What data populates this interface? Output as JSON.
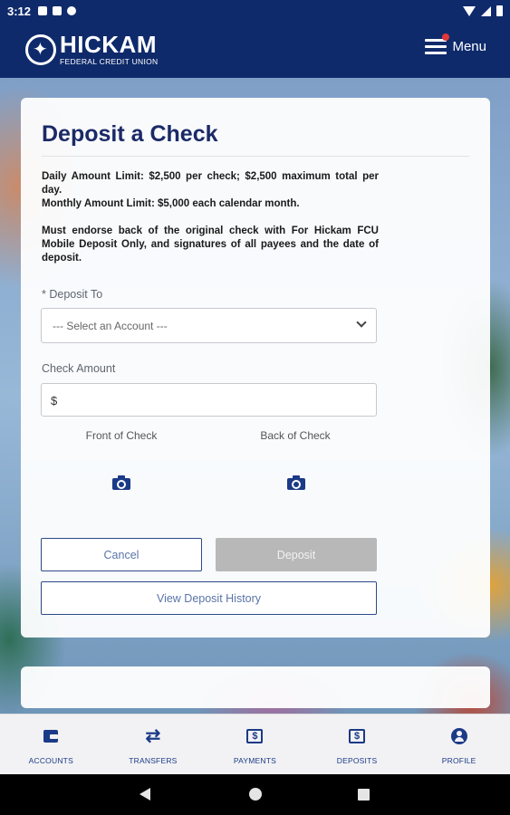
{
  "status_bar": {
    "time": "3:12",
    "icons": [
      "notification-icon",
      "sim-icon",
      "sync-icon",
      "wifi-icon",
      "cell-signal-icon",
      "battery-icon"
    ]
  },
  "header": {
    "logo_name": "HICKAM",
    "logo_subtitle": "FEDERAL CREDIT UNION",
    "menu_label": "Menu",
    "notification_dot_color": "#e0383a",
    "brand_color": "#0f2a6b"
  },
  "form": {
    "title": "Deposit a Check",
    "limits_line_1": "Daily Amount Limit: $2,500 per check; $2,500 maximum total per day.",
    "limits_line_2": "Monthly Amount Limit: $5,000 each calendar month.",
    "endorse_text": "Must endorse back of the original check with For Hickam FCU Mobile Deposit Only, and signatures of all payees and the date of deposit.",
    "deposit_to_label": "* Deposit To",
    "deposit_to_value": "--- Select an Account ---",
    "check_amount_label": "Check Amount",
    "check_amount_prefix": "$",
    "check_amount_value": "",
    "front_label": "Front of Check",
    "back_label": "Back of Check",
    "cancel_label": "Cancel",
    "deposit_label": "Deposit",
    "history_label": "View Deposit History"
  },
  "bottom_nav": {
    "items": [
      {
        "label": "ACCOUNTS",
        "icon": "accounts-icon"
      },
      {
        "label": "TRANSFERS",
        "icon": "transfer-arrows-icon"
      },
      {
        "label": "PAYMENTS",
        "icon": "payments-icon"
      },
      {
        "label": "DEPOSITS",
        "icon": "deposits-icon"
      },
      {
        "label": "PROFILE",
        "icon": "profile-icon"
      }
    ],
    "transfer_glyph": "⇄",
    "payments_glyph": "$",
    "deposits_glyph": "$"
  },
  "android_nav": {
    "icons": [
      "back-icon",
      "home-icon",
      "recents-icon"
    ]
  }
}
